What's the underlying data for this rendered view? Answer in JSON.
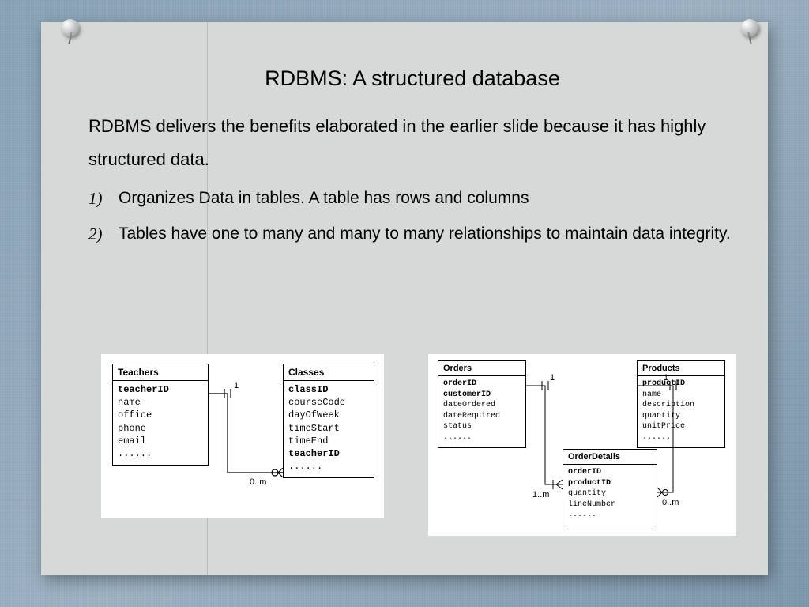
{
  "slide": {
    "title": "RDBMS: A structured database",
    "intro": "RDBMS delivers the benefits elaborated in the earlier slide because it has highly structured data.",
    "points": [
      "Organizes Data in tables. A table has rows and columns",
      "Tables have one to many and many to many relationships to maintain data integrity."
    ]
  },
  "diagram_left": {
    "entity1": {
      "name": "Teachers",
      "fields": "teacherID\nname\noffice\nphone\nemail\n......"
    },
    "entity2": {
      "name": "Classes",
      "fields": "classID\ncourseCode\ndayOfWeek\ntimeStart\ntimeEnd\nteacherID\n......"
    },
    "card1": "1",
    "card2": "0..m"
  },
  "diagram_right": {
    "entity1": {
      "name": "Orders",
      "fields": "orderID\ncustomerID\ndateOrdered\ndateRequired\nstatus\n......"
    },
    "entity2": {
      "name": "Products",
      "fields": "productID\nname\ndescription\nquantity\nunitPrice\n......"
    },
    "entity3": {
      "name": "OrderDetails",
      "fields": "orderID\nproductID\nquantity\nlineNumber\n......"
    },
    "card1": "1",
    "card2": "1",
    "card3": "1..m",
    "card4": "0..m"
  }
}
